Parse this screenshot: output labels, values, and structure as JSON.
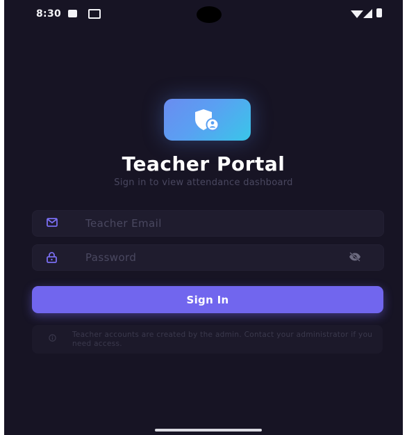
{
  "status_bar": {
    "time": "8:30"
  },
  "app": {
    "title": "Teacher Portal",
    "subtitle": "Sign in to view attendance dashboard"
  },
  "form": {
    "email_placeholder": "Teacher Email",
    "password_placeholder": "Password",
    "submit_label": "Sign In"
  },
  "info": {
    "text": "Teacher accounts are created by the admin. Contact your administrator if you need access."
  },
  "icons": {
    "logo": "shield-user-icon",
    "email": "mail-icon",
    "password": "lock-icon",
    "visibility": "eye-off-icon",
    "info": "info-icon"
  },
  "colors": {
    "background": "#171424",
    "accent": "#7166ee",
    "field": "#1f1c2e"
  }
}
